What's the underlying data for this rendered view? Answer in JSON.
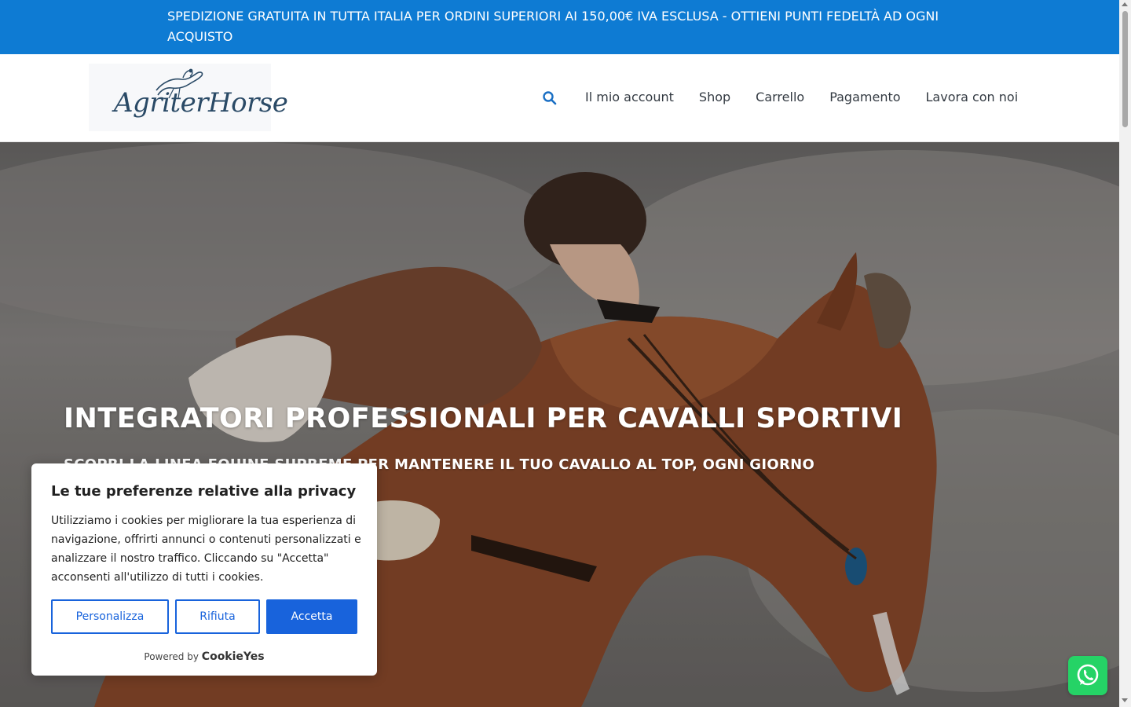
{
  "topbar": {
    "message": "SPEDIZIONE GRATUITA IN TUTTA ITALIA PER ORDINI SUPERIORI AI 150,00€ IVA ESCLUSA - OTTIENI PUNTI FEDELTÀ AD OGNI ACQUISTO",
    "background": "#0e7bd3"
  },
  "header": {
    "logo_text": "AgriterHorse",
    "search_icon": "search-icon",
    "nav": [
      {
        "label": "Il mio account"
      },
      {
        "label": "Shop"
      },
      {
        "label": "Carrello"
      },
      {
        "label": "Pagamento"
      },
      {
        "label": "Lavora con noi"
      }
    ]
  },
  "hero": {
    "title": "INTEGRATORI PROFESSIONALI PER CAVALLI SPORTIVI",
    "subtitle": "SCOPRI LA LINEA EQUINE SUPREME PER MANTENERE IL TUO CAVALLO AL TOP, OGNI GIORNO"
  },
  "cookie_banner": {
    "title": "Le tue preferenze relative alla privacy",
    "body": "Utilizziamo i cookies per migliorare la tua esperienza di navigazione, offrirti annunci o contenuti personalizzati e analizzare il nostro traffico. Cliccando su \"Accetta\" acconsenti all'utilizzo di tutti i cookies.",
    "buttons": {
      "customize": "Personalizza",
      "reject": "Rifiuta",
      "accept": "Accetta"
    },
    "powered_by": "Powered by",
    "brand": "CookieYes",
    "accent": "#1863dc"
  },
  "whatsapp": {
    "icon": "whatsapp-icon",
    "color": "#25d366"
  }
}
